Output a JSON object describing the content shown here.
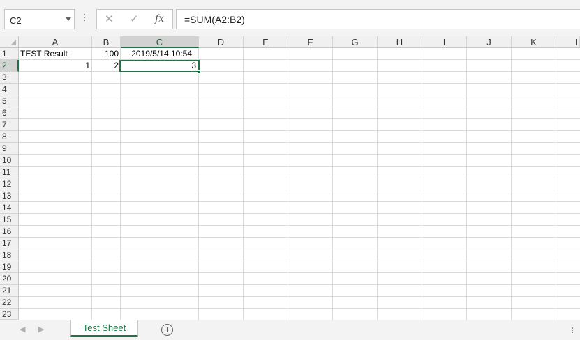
{
  "formula_bar": {
    "name_box": "C2",
    "cancel_icon": "✕",
    "enter_icon": "✓",
    "fx_label": "fx",
    "formula": "=SUM(A2:B2)"
  },
  "columns": [
    "A",
    "B",
    "C",
    "D",
    "E",
    "F",
    "G",
    "H",
    "I",
    "J",
    "K",
    "L"
  ],
  "rows": [
    "1",
    "2",
    "3",
    "4",
    "5",
    "6",
    "7",
    "8",
    "9",
    "10",
    "11",
    "12",
    "13",
    "14",
    "15",
    "16",
    "17",
    "18",
    "19",
    "20",
    "21",
    "22",
    "23"
  ],
  "cells": {
    "A1": "TEST Result",
    "B1": "100",
    "C1": "2019/5/14 10:54",
    "A2": "1",
    "B2": "2",
    "C2": "3"
  },
  "selected_cell": "C2",
  "sheet_tabs": {
    "active": "Test Sheet",
    "add_icon": "+"
  },
  "colors": {
    "accent": "#217346",
    "grid": "#d9d9d9",
    "header_bg": "#f0f0f0"
  }
}
